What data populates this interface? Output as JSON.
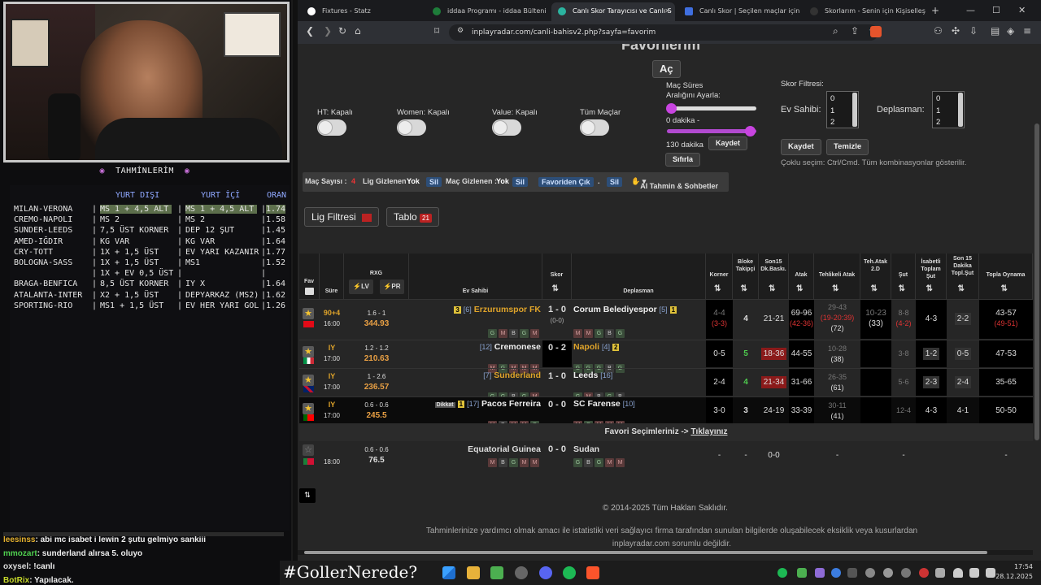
{
  "overlay": {
    "panel_title": "TAHMİNLERİM",
    "col_headers": [
      "YURT DIŞI",
      "YURT İÇİ",
      "ORAN"
    ],
    "rows": [
      {
        "match": "MILAN-VERONA",
        "yurt_disi": "MS 1 + 4,5 ALT",
        "yurt_ici": "MS 1 + 4,5 ALT",
        "oran": "1.74",
        "dot": false,
        "highlight": true
      },
      {
        "match": "CREMO-NAPOLI",
        "yurt_disi": "MS 2",
        "yurt_ici": "MS 2",
        "oran": "1.58",
        "dot": true
      },
      {
        "match": "SUNDER-LEEDS",
        "yurt_disi": "7,5 ÜST KORNER",
        "yurt_ici": "DEP 12 ŞUT",
        "oran": "1.45",
        "dot": true
      },
      {
        "match": "AMED-IĞDIR",
        "yurt_disi": "KG VAR",
        "yurt_ici": "KG VAR",
        "oran": "1.64",
        "dot": false
      },
      {
        "match": "CRY-TOTT",
        "yurt_disi": "1X + 1,5 ÜST",
        "yurt_ici": "EV YARI KAZANIR",
        "oran": "1.77",
        "dot": false
      },
      {
        "match": "BOLOGNA-SASS",
        "yurt_disi": "1X + 1,5 ÜST",
        "yurt_ici": "MS1",
        "oran": "1.52",
        "dot": false
      },
      {
        "match": "",
        "yurt_disi": "1X + EV 0,5 ÜST",
        "yurt_ici": "",
        "oran": "",
        "dot": false
      },
      {
        "match": "BRAGA-BENFICA",
        "yurt_disi": "8,5 ÜST KORNER",
        "yurt_ici": "IY X",
        "oran": "1.64",
        "dot": false
      },
      {
        "match": "ATALANTA-INTER",
        "yurt_disi": "X2 + 1,5 ÜST",
        "yurt_ici": "DEPYARKAZ (MS2)",
        "oran": "1.62",
        "dot": true
      },
      {
        "match": "SPORTING-RIO",
        "yurt_disi": "MS1 + 1,5 ÜST",
        "yurt_ici": "EV HER YARI GOL",
        "oran": "1.26",
        "dot": true
      }
    ],
    "chat": [
      {
        "user": "leesinss",
        "text": ": abi mc isabet i lewin 2 şutu gelmiyo sankiii"
      },
      {
        "user": "mmozart",
        "text": ": sunderland alırsa 5. oluyo"
      },
      {
        "user": "oxysel",
        "text": ": !canlı"
      },
      {
        "user": "BotRix",
        "text": ": Yapılacak."
      }
    ]
  },
  "browser": {
    "tabs": [
      {
        "label": "Fixtures - Statz",
        "active": false,
        "color": "#ffffff"
      },
      {
        "label": "iddaa Programı - iddaa Bülteni | id",
        "active": false,
        "color": "#1e7d3a"
      },
      {
        "label": "Canlı Skor Tarayıcısı ve Canlı S",
        "active": true,
        "color": "#2bb4a0"
      },
      {
        "label": "Canlı Skor | Seçilen maçlar için ca",
        "active": false,
        "color": "#3f6fe0"
      },
      {
        "label": "Skorlarım - Senin için Kişiselleştir",
        "active": false,
        "color": "#222222"
      }
    ],
    "url": "inplayradar.com/canli-bahisv2.php?sayfa=favorim"
  },
  "page": {
    "heading_partial": "Favorilerim",
    "open_button": "Aç",
    "toggles": [
      {
        "label": "HT: Kapalı"
      },
      {
        "label": "Women: Kapalı"
      },
      {
        "label": "Value: Kapalı"
      },
      {
        "label": "Tüm Maçlar"
      }
    ],
    "duration": {
      "title": "Maç Süres Aralığını Ayarla:",
      "min_label": "0 dakika -",
      "max_label": "130 dakika",
      "save": "Kaydet",
      "reset": "Sıfırla"
    },
    "score_filter": {
      "title": "Skor Filtresi:",
      "home_label": "Ev Sahibi:",
      "away_label": "Deplasman:",
      "options": [
        "0",
        "1",
        "2"
      ],
      "save": "Kaydet",
      "clear": "Temizle",
      "hint": "Çoklu seçim: Ctrl/Cmd. Tüm kombinasyonlar gösterilir."
    },
    "bar": {
      "mac_sayisi": "Maç Sayısı :",
      "mac_sayisi_val": "4",
      "lig_gizlenen": "Lig Gizlenen :",
      "lig_gizlenen_val": "Yok",
      "sil1": "Sil",
      "mac_gizlenen": "Maç Gizlenen :",
      "mac_gizlenen_val": "Yok",
      "sil2": "Sil",
      "favoriden": "Favoriden Çık",
      "sil3": "Sil",
      "ai": "AI Tahmin & Sohbetler"
    },
    "lig_filtresi": "Lig Filtresi",
    "tablo": "Tablo",
    "tablo_count": "21",
    "headers": {
      "fav": "Fav",
      "sure": "Süre",
      "rxg": "RXG",
      "lv": "LV",
      "pr": "PR",
      "home": "Ev Sahibi",
      "skor": "Skor",
      "away": "Deplasman",
      "korner": "Korner",
      "blokeTakipci": "Bloke Takipçi",
      "son15": "Son15 Dk.Baskı.",
      "atak": "Atak",
      "tehlikeli": "Tehlikeli Atak",
      "teh2d": "Teh.Atak 2.D",
      "sut": "Şut",
      "isabetli": "İsabetli Toplam Şut",
      "son15sut": "Son 15 Dakika Topl.Şut",
      "topla": "Topla Oynama"
    },
    "matches": [
      {
        "time": "90+4",
        "clock": "16:00",
        "rxg": "1.6 - 1",
        "rxgscore": "344.93",
        "home": "Erzurumspor FK",
        "home_rank": "[6]",
        "home_badge": "3",
        "score": "1 - 0",
        "ht": "(0-0)",
        "away": "Corum Belediyespor",
        "away_rank": "[5]",
        "away_badge": "1",
        "home_form": [
          "G",
          "M",
          "B",
          "G",
          "M"
        ],
        "away_form": [
          "M",
          "M",
          "G",
          "B",
          "G"
        ],
        "korner": "4-4",
        "korner2": "(3-3)",
        "bloke": "4",
        "son15": "21-21",
        "atak": "69-96",
        "atak2": "(42-36)",
        "tehlikeli": "29-43",
        "tehlikeli2": "(19-20:39)",
        "tehlikeli3": "(72)",
        "teh2d": "10-23",
        "teh2d2": "(33)",
        "sut": "8-8",
        "sut2": "(4-2)",
        "isabetli": "4-3",
        "son15sut": "2-2",
        "topla": "43-57",
        "topla2": "(49-51)"
      },
      {
        "time": "IY",
        "clock": "17:00",
        "rxg": "1.2 - 1.2",
        "rxgscore": "210.63",
        "home": "Cremonese",
        "home_rank": "[12]",
        "home_badge": "",
        "score": "0 - 2",
        "ht": "",
        "away": "Napoli",
        "away_rank": "[4]",
        "away_badge": "2",
        "home_form": [
          "M",
          "G",
          "M",
          "M",
          "M"
        ],
        "away_form": [
          "G",
          "G",
          "G",
          "B",
          "G"
        ],
        "korner": "0-5",
        "korner2": "",
        "bloke": "5",
        "son15": "18-36",
        "atak": "44-55",
        "atak2": "",
        "tehlikeli": "10-28",
        "tehlikeli2": "",
        "tehlikeli3": "(38)",
        "teh2d": "",
        "teh2d2": "",
        "sut": "3-8",
        "sut2": "",
        "isabetli": "1-2",
        "son15sut": "0-5",
        "topla": "47-53",
        "topla2": ""
      },
      {
        "time": "IY",
        "clock": "17:00",
        "rxg": "1 - 2.6",
        "rxgscore": "236.57",
        "home": "Sunderland",
        "home_rank": "[7]",
        "home_badge": "",
        "score": "1 - 0",
        "ht": "",
        "away": "Leeds",
        "away_rank": "[16]",
        "away_badge": "",
        "home_form": [
          "G",
          "G",
          "B",
          "G",
          "M"
        ],
        "away_form": [
          "G",
          "M",
          "B",
          "G",
          "B"
        ],
        "korner": "2-4",
        "korner2": "",
        "bloke": "4",
        "son15": "21-34",
        "atak": "31-66",
        "atak2": "",
        "tehlikeli": "26-35",
        "tehlikeli2": "",
        "tehlikeli3": "(61)",
        "teh2d": "",
        "teh2d2": "",
        "sut": "5-6",
        "sut2": "",
        "isabetli": "2-3",
        "son15sut": "2-4",
        "topla": "35-65",
        "topla2": ""
      },
      {
        "time": "IY",
        "clock": "17:00",
        "rxg": "0.6 - 0.6",
        "rxgscore": "245.5",
        "home": "Pacos Ferreira",
        "home_rank": "[17]",
        "home_badge": "1",
        "score": "0 - 0",
        "ht": "",
        "away": "SC Farense",
        "away_rank": "[10]",
        "away_badge": "",
        "home_form": [
          "M",
          "B",
          "M",
          "M",
          "G"
        ],
        "away_form": [
          "M",
          "G",
          "M",
          "M",
          "M"
        ],
        "korner": "3-0",
        "korner2": "",
        "bloke": "3",
        "son15": "24-19",
        "atak": "33-39",
        "atak2": "",
        "tehlikeli": "30-11",
        "tehlikeli2": "",
        "tehlikeli3": "(41)",
        "teh2d": "",
        "teh2d2": "",
        "sut": "12-4",
        "sut2": "",
        "isabetli": "4-3",
        "son15sut": "4-1",
        "topla": "50-50",
        "topla2": "",
        "dikkat": "Dikkat"
      }
    ],
    "fav_banner": "Favori Seçimleriniz ->",
    "fav_link": "Tıklayınız",
    "extra": {
      "clock": "18:00",
      "rxg": "0.6 - 0.6",
      "rxgscore": "76.5",
      "home": "Equatorial Guinea",
      "score": "0 - 0",
      "away": "Sudan",
      "home_form": [
        "M",
        "B",
        "G",
        "M",
        "M"
      ],
      "away_form": [
        "G",
        "B",
        "G",
        "M",
        "M"
      ],
      "korner": "-",
      "bloke": "-",
      "son15": "0-0",
      "tehlikeli": "-",
      "sut": "-",
      "topla": "-"
    },
    "copyright": "© 2014-2025 Tüm Hakları Saklıdır.",
    "disclaimer": "Tahminlerinize yardımcı olmak amacı ile istatistiki veri sağlayıcı firma tarafından sunulan bilgilerde oluşabilecek eksiklik veya kusurlardan inplayradar.com sorumlu değildir."
  },
  "taskbar": {
    "hashtag": "#GollerNerede?",
    "time": "17:54",
    "date": "28.12.2025"
  },
  "colors": {
    "accent": "#c844e0",
    "gold": "#e0a42a",
    "rxgscore": "#e9a044"
  }
}
